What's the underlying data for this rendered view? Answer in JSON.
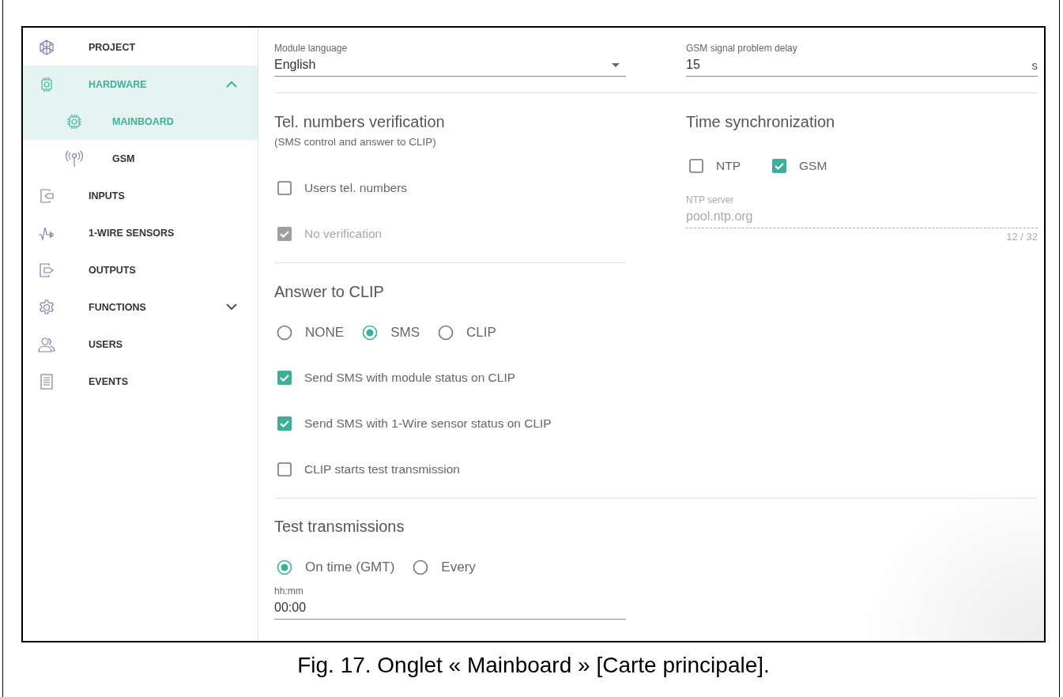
{
  "sidebar": {
    "items": [
      {
        "label": "PROJECT",
        "selected": false
      },
      {
        "label": "HARDWARE",
        "selected": true,
        "expanded": true,
        "children": [
          {
            "label": "MAINBOARD",
            "selected": true
          },
          {
            "label": "GSM",
            "selected": false
          }
        ]
      },
      {
        "label": "INPUTS",
        "selected": false
      },
      {
        "label": "1-WIRE SENSORS",
        "selected": false
      },
      {
        "label": "OUTPUTS",
        "selected": false
      },
      {
        "label": "FUNCTIONS",
        "selected": false,
        "expanded": false
      },
      {
        "label": "USERS",
        "selected": false
      },
      {
        "label": "EVENTS",
        "selected": false
      }
    ]
  },
  "module_language": {
    "label": "Module language",
    "value": "English"
  },
  "gsm_signal_delay": {
    "label": "GSM signal problem delay",
    "value": "15",
    "unit": "s"
  },
  "tel_numbers_verification": {
    "title": "Tel. numbers verification",
    "subtitle": "(SMS control and answer to CLIP)",
    "options": [
      {
        "label": "Users tel. numbers",
        "checked": false,
        "disabled": false
      },
      {
        "label": "No verification",
        "checked": true,
        "disabled": true
      }
    ]
  },
  "time_synchronization": {
    "title": "Time synchronization",
    "options": [
      {
        "label": "NTP",
        "checked": false,
        "disabled": false
      },
      {
        "label": "GSM",
        "checked": true,
        "disabled": false
      }
    ],
    "ntp_server": {
      "label": "NTP server",
      "value": "pool.ntp.org",
      "counter": "12 / 32",
      "disabled": true
    }
  },
  "answer_to_clip": {
    "title": "Answer to CLIP",
    "modes": [
      {
        "label": "NONE",
        "selected": false
      },
      {
        "label": "SMS",
        "selected": true
      },
      {
        "label": "CLIP",
        "selected": false
      }
    ],
    "options": [
      {
        "label": "Send SMS with module status on CLIP",
        "checked": true,
        "disabled": false
      },
      {
        "label": "Send SMS with 1-Wire sensor status on CLIP",
        "checked": true,
        "disabled": false
      },
      {
        "label": "CLIP starts test transmission",
        "checked": false,
        "disabled": false
      }
    ]
  },
  "test_transmissions": {
    "title": "Test transmissions",
    "modes": [
      {
        "label": "On time (GMT)",
        "selected": true
      },
      {
        "label": "Every",
        "selected": false
      }
    ],
    "time": {
      "label": "hh:mm",
      "value": "00:00"
    }
  },
  "caption": "Fig. 17. Onglet « Mainboard » [Carte principale]."
}
